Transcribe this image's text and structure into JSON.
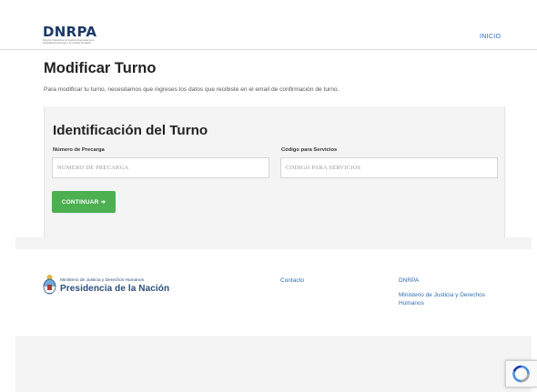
{
  "header": {
    "logo_title": "DNRPA",
    "logo_subtitle": "Dirección Nacional de los Registros Nacionales de la Propiedad del Automotor y de Créditos Prendarios",
    "nav_inicio": "INICIO"
  },
  "main": {
    "title": "Modificar Turno",
    "description": "Para modificar tu turno, necesitamos que ingreses los datos que recibiste en el email de confirmación de turno."
  },
  "form": {
    "title": "Identificación del Turno",
    "precarga_label": "Número de Precarga",
    "precarga_placeholder": "NÚMERO DE PRECARGA",
    "codigo_label": "Código para Servicios",
    "codigo_placeholder": "CÓDIGO PARA SERVICIOS",
    "continuar_label": "CONTINUAR",
    "continuar_icon": "arrow-right-icon"
  },
  "footer": {
    "ministerio_small": "Ministerio de Justicia y Derechos Humanos",
    "presidencia": "Presidencia de la Nación",
    "contacto": "Contacto",
    "dnrpa": "DNRPA",
    "ministerio_link": "Ministerio de Justicia y Derechos Humanos"
  },
  "colors": {
    "brand": "#1b3a67",
    "link": "#2d6db3",
    "button": "#4caf50"
  }
}
